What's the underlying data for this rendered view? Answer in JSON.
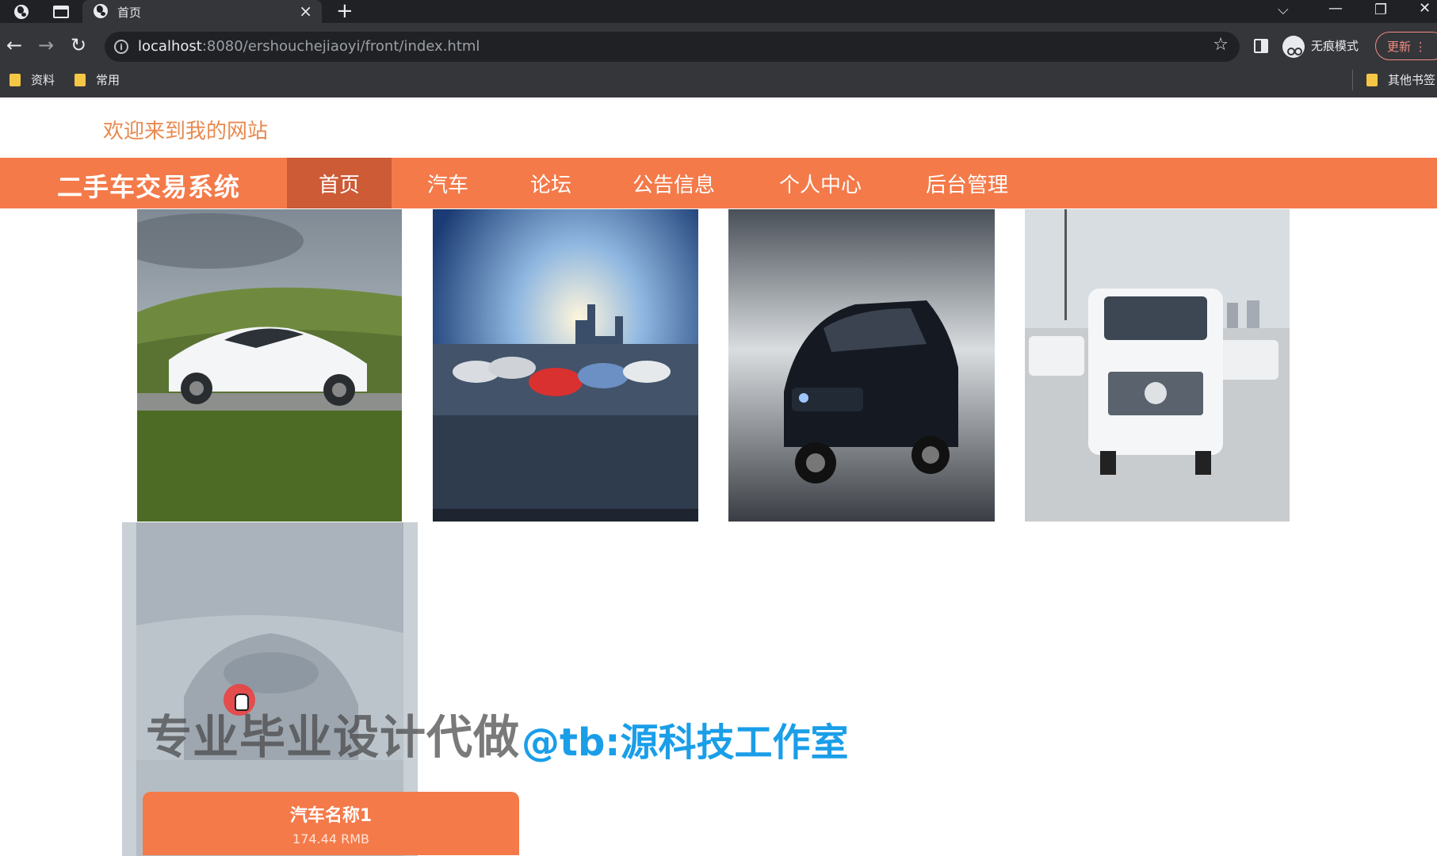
{
  "browser": {
    "tab_title": "首页",
    "url_host": "localhost",
    "url_rest": ":8080/ershouchejiaoyi/front/index.html",
    "incognito_label": "无痕模式",
    "update_label": "更新",
    "bookmarks": [
      "资料",
      "常用"
    ],
    "other_bookmarks": "其他书签"
  },
  "site": {
    "welcome": "欢迎来到我的网站",
    "name": "二手车交易系统",
    "nav": [
      {
        "label": "首页",
        "active": true
      },
      {
        "label": "汽车",
        "active": false
      },
      {
        "label": "论坛",
        "active": false
      },
      {
        "label": "公告信息",
        "active": false
      },
      {
        "label": "个人中心",
        "active": false
      },
      {
        "label": "后台管理",
        "active": false
      }
    ]
  },
  "car_card": {
    "name": "汽车名称1",
    "price": "174.44 RMB"
  },
  "watermark": {
    "left": "专业毕业设计代做",
    "right": "@tb:源科技工作室"
  },
  "colors": {
    "nav_bg": "#f47a4a",
    "nav_active": "#cc5b36",
    "welcome_text": "#e8894f",
    "watermark_blue": "#1a9ee8"
  }
}
